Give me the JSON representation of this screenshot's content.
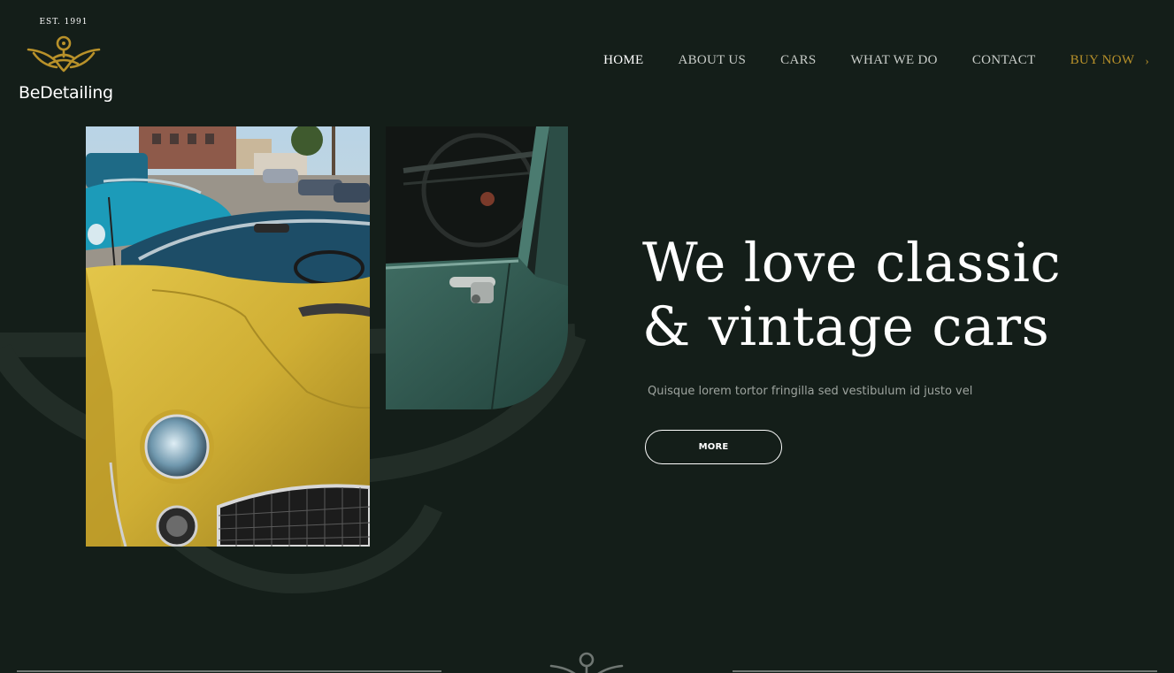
{
  "brand": {
    "est": "EST. 1991",
    "name": "BeDetailing",
    "logo_color": "#b8912a"
  },
  "nav": {
    "items": [
      {
        "label": "HOME",
        "active": true
      },
      {
        "label": "ABOUT US",
        "active": false
      },
      {
        "label": "CARS",
        "active": false
      },
      {
        "label": "WHAT WE DO",
        "active": false
      },
      {
        "label": "CONTACT",
        "active": false
      }
    ],
    "buy": {
      "label": "BUY NOW",
      "icon": "chevron-right-icon",
      "color": "#b8912a"
    }
  },
  "hero": {
    "title_line1": "We love classic",
    "title_line2": "& vintage cars",
    "subtitle": "Quisque lorem tortor fringilla sed vestibulum id justo vel",
    "button_label": "MORE"
  },
  "colors": {
    "background": "#141e19",
    "accent": "#b8912a",
    "text": "#ffffff",
    "muted": "#9ea49f"
  }
}
